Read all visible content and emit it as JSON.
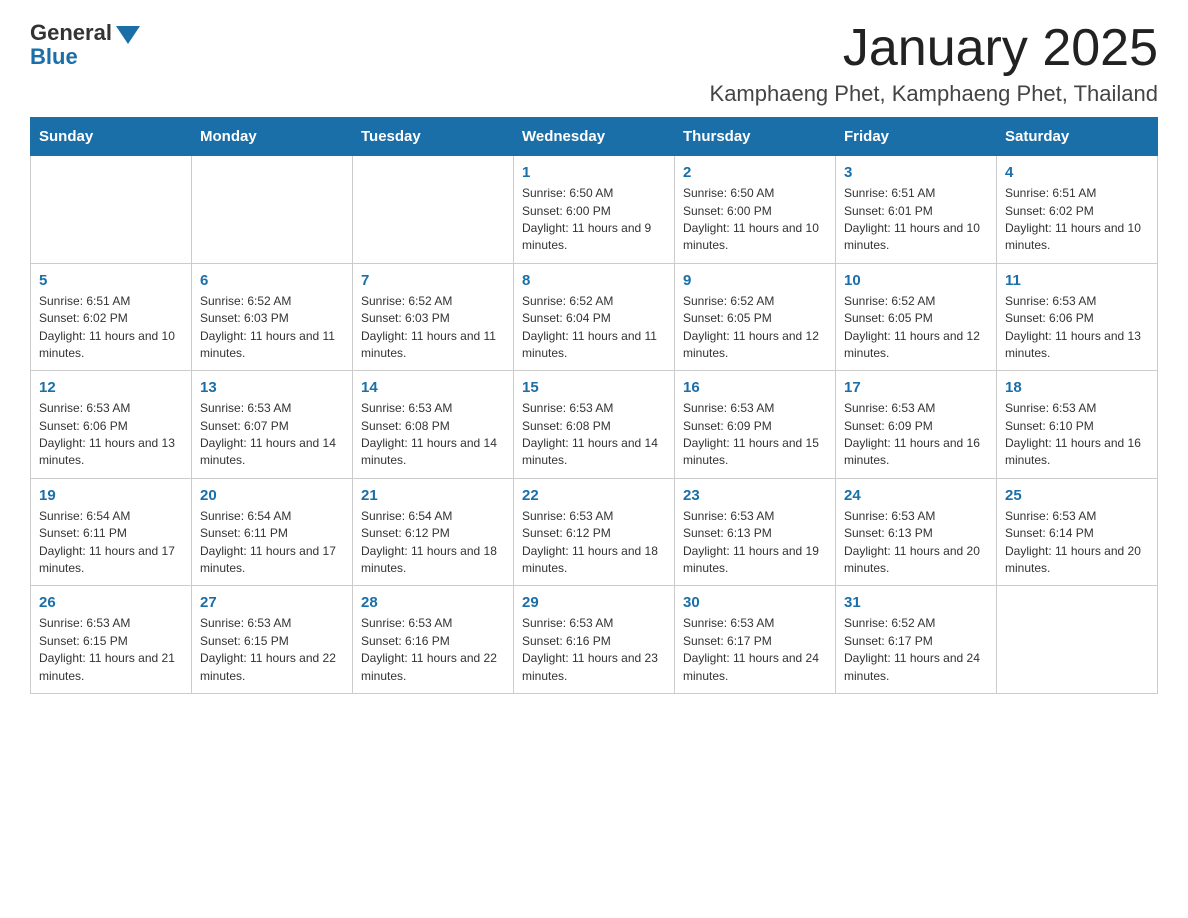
{
  "logo": {
    "general": "General",
    "blue": "Blue"
  },
  "header": {
    "month_title": "January 2025",
    "location": "Kamphaeng Phet, Kamphaeng Phet, Thailand"
  },
  "days_of_week": [
    "Sunday",
    "Monday",
    "Tuesday",
    "Wednesday",
    "Thursday",
    "Friday",
    "Saturday"
  ],
  "weeks": [
    [
      {
        "day": "",
        "info": ""
      },
      {
        "day": "",
        "info": ""
      },
      {
        "day": "",
        "info": ""
      },
      {
        "day": "1",
        "info": "Sunrise: 6:50 AM\nSunset: 6:00 PM\nDaylight: 11 hours and 9 minutes."
      },
      {
        "day": "2",
        "info": "Sunrise: 6:50 AM\nSunset: 6:00 PM\nDaylight: 11 hours and 10 minutes."
      },
      {
        "day": "3",
        "info": "Sunrise: 6:51 AM\nSunset: 6:01 PM\nDaylight: 11 hours and 10 minutes."
      },
      {
        "day": "4",
        "info": "Sunrise: 6:51 AM\nSunset: 6:02 PM\nDaylight: 11 hours and 10 minutes."
      }
    ],
    [
      {
        "day": "5",
        "info": "Sunrise: 6:51 AM\nSunset: 6:02 PM\nDaylight: 11 hours and 10 minutes."
      },
      {
        "day": "6",
        "info": "Sunrise: 6:52 AM\nSunset: 6:03 PM\nDaylight: 11 hours and 11 minutes."
      },
      {
        "day": "7",
        "info": "Sunrise: 6:52 AM\nSunset: 6:03 PM\nDaylight: 11 hours and 11 minutes."
      },
      {
        "day": "8",
        "info": "Sunrise: 6:52 AM\nSunset: 6:04 PM\nDaylight: 11 hours and 11 minutes."
      },
      {
        "day": "9",
        "info": "Sunrise: 6:52 AM\nSunset: 6:05 PM\nDaylight: 11 hours and 12 minutes."
      },
      {
        "day": "10",
        "info": "Sunrise: 6:52 AM\nSunset: 6:05 PM\nDaylight: 11 hours and 12 minutes."
      },
      {
        "day": "11",
        "info": "Sunrise: 6:53 AM\nSunset: 6:06 PM\nDaylight: 11 hours and 13 minutes."
      }
    ],
    [
      {
        "day": "12",
        "info": "Sunrise: 6:53 AM\nSunset: 6:06 PM\nDaylight: 11 hours and 13 minutes."
      },
      {
        "day": "13",
        "info": "Sunrise: 6:53 AM\nSunset: 6:07 PM\nDaylight: 11 hours and 14 minutes."
      },
      {
        "day": "14",
        "info": "Sunrise: 6:53 AM\nSunset: 6:08 PM\nDaylight: 11 hours and 14 minutes."
      },
      {
        "day": "15",
        "info": "Sunrise: 6:53 AM\nSunset: 6:08 PM\nDaylight: 11 hours and 14 minutes."
      },
      {
        "day": "16",
        "info": "Sunrise: 6:53 AM\nSunset: 6:09 PM\nDaylight: 11 hours and 15 minutes."
      },
      {
        "day": "17",
        "info": "Sunrise: 6:53 AM\nSunset: 6:09 PM\nDaylight: 11 hours and 16 minutes."
      },
      {
        "day": "18",
        "info": "Sunrise: 6:53 AM\nSunset: 6:10 PM\nDaylight: 11 hours and 16 minutes."
      }
    ],
    [
      {
        "day": "19",
        "info": "Sunrise: 6:54 AM\nSunset: 6:11 PM\nDaylight: 11 hours and 17 minutes."
      },
      {
        "day": "20",
        "info": "Sunrise: 6:54 AM\nSunset: 6:11 PM\nDaylight: 11 hours and 17 minutes."
      },
      {
        "day": "21",
        "info": "Sunrise: 6:54 AM\nSunset: 6:12 PM\nDaylight: 11 hours and 18 minutes."
      },
      {
        "day": "22",
        "info": "Sunrise: 6:53 AM\nSunset: 6:12 PM\nDaylight: 11 hours and 18 minutes."
      },
      {
        "day": "23",
        "info": "Sunrise: 6:53 AM\nSunset: 6:13 PM\nDaylight: 11 hours and 19 minutes."
      },
      {
        "day": "24",
        "info": "Sunrise: 6:53 AM\nSunset: 6:13 PM\nDaylight: 11 hours and 20 minutes."
      },
      {
        "day": "25",
        "info": "Sunrise: 6:53 AM\nSunset: 6:14 PM\nDaylight: 11 hours and 20 minutes."
      }
    ],
    [
      {
        "day": "26",
        "info": "Sunrise: 6:53 AM\nSunset: 6:15 PM\nDaylight: 11 hours and 21 minutes."
      },
      {
        "day": "27",
        "info": "Sunrise: 6:53 AM\nSunset: 6:15 PM\nDaylight: 11 hours and 22 minutes."
      },
      {
        "day": "28",
        "info": "Sunrise: 6:53 AM\nSunset: 6:16 PM\nDaylight: 11 hours and 22 minutes."
      },
      {
        "day": "29",
        "info": "Sunrise: 6:53 AM\nSunset: 6:16 PM\nDaylight: 11 hours and 23 minutes."
      },
      {
        "day": "30",
        "info": "Sunrise: 6:53 AM\nSunset: 6:17 PM\nDaylight: 11 hours and 24 minutes."
      },
      {
        "day": "31",
        "info": "Sunrise: 6:52 AM\nSunset: 6:17 PM\nDaylight: 11 hours and 24 minutes."
      },
      {
        "day": "",
        "info": ""
      }
    ]
  ]
}
